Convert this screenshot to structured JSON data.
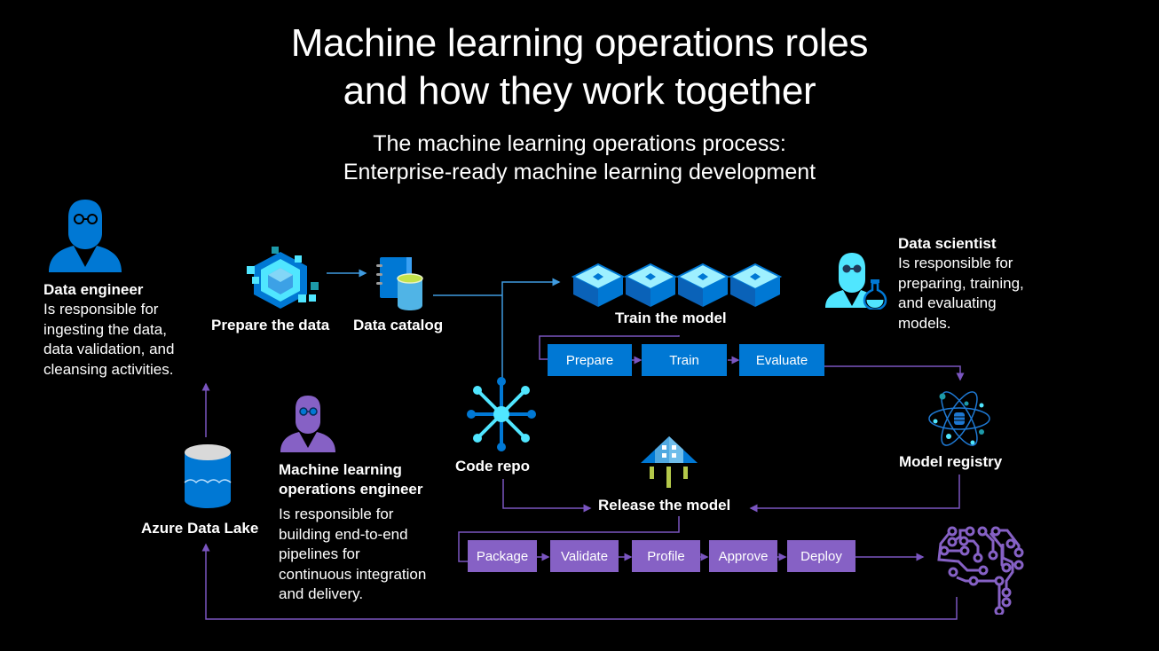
{
  "header": {
    "title_line1": "Machine learning operations roles",
    "title_line2": "and how they work together",
    "subtitle_line1": "The machine learning operations process:",
    "subtitle_line2": "Enterprise-ready machine learning development"
  },
  "roles": {
    "data_engineer": {
      "icon": "person-with-glasses-icon",
      "title": "Data engineer",
      "desc": [
        "Is responsible for",
        "ingesting the data,",
        "data validation, and",
        "cleansing activities."
      ]
    },
    "data_scientist": {
      "icon": "scientist-with-flask-icon",
      "title": "Data scientist",
      "desc": [
        "Is responsible for",
        "preparing, training,",
        "and evaluating",
        "models."
      ]
    },
    "mlops_engineer": {
      "icon": "person-with-glasses-icon",
      "title_lines": [
        "Machine learning",
        "operations engineer"
      ],
      "desc": [
        "Is responsible for",
        "building end-to-end",
        "pipelines for",
        "continuous integration",
        "and delivery."
      ]
    }
  },
  "nodes": {
    "prepare_data": {
      "label": "Prepare the data",
      "icon": "data-prep-cubes-icon"
    },
    "data_catalog": {
      "label": "Data catalog",
      "icon": "catalog-book-database-icon"
    },
    "train_model": {
      "label": "Train the model",
      "icon": "compute-blocks-icon"
    },
    "code_repo": {
      "label": "Code repo",
      "icon": "repo-hub-icon"
    },
    "model_registry": {
      "label": "Model registry",
      "icon": "atom-registry-icon"
    },
    "release_model": {
      "label": "Release the model",
      "icon": "release-rocket-house-icon"
    },
    "azure_data_lake": {
      "label": "Azure Data Lake",
      "icon": "data-lake-cylinder-icon"
    },
    "ai_brain": {
      "icon": "circuit-brain-icon"
    }
  },
  "train_steps": [
    "Prepare",
    "Train",
    "Evaluate"
  ],
  "release_steps": [
    "Package",
    "Validate",
    "Profile",
    "Approve",
    "Deploy"
  ],
  "colors": {
    "background": "#000000",
    "azure_blue": "#0078d4",
    "purple": "#8661c5",
    "cyan": "#50e6ff",
    "connector_blue": "#3f9be0",
    "connector_purple": "#7a55c0"
  }
}
